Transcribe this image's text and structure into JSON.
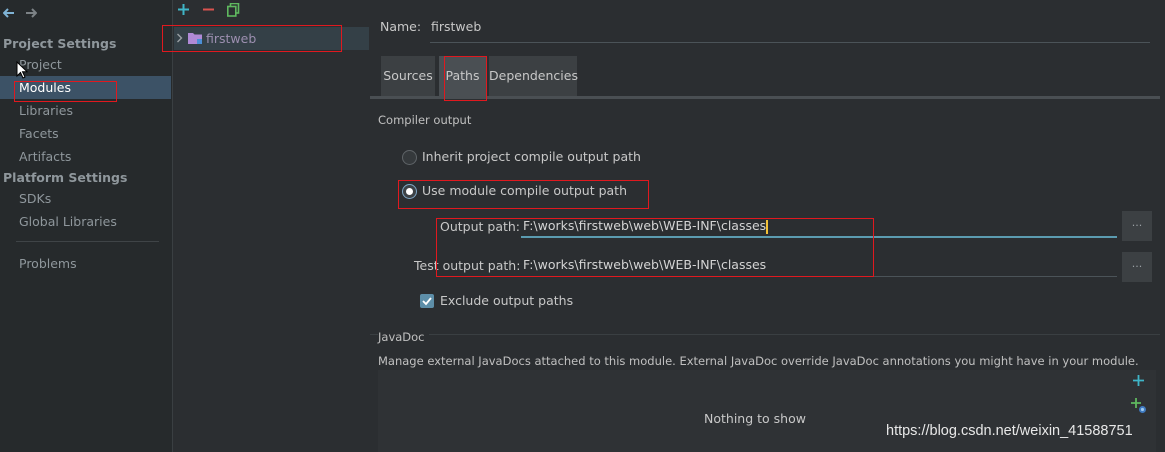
{
  "sidebar": {
    "back_icon": "arrow-left-icon",
    "forward_icon": "arrow-right-icon",
    "project_settings_header": "Project Settings",
    "project_settings_items": [
      "Project",
      "Modules",
      "Libraries",
      "Facets",
      "Artifacts"
    ],
    "platform_settings_header": "Platform Settings",
    "platform_settings_items": [
      "SDKs",
      "Global Libraries"
    ],
    "problems_label": "Problems",
    "selected": "Modules"
  },
  "tree": {
    "toolbar": [
      "add-icon",
      "remove-icon",
      "copy-icon"
    ],
    "module_name": "firstweb"
  },
  "module": {
    "name_label": "Name:",
    "name_value": "firstweb",
    "tabs": [
      "Sources",
      "Paths",
      "Dependencies"
    ],
    "active_tab": "Paths"
  },
  "compiler_output": {
    "title": "Compiler output",
    "inherit_label": "Inherit project compile output path",
    "use_module_label": "Use module compile output path",
    "selected_option": "use_module",
    "output_path_label": "Output path:",
    "output_path_value": "F:\\works\\firstweb\\web\\WEB-INF\\classes",
    "test_output_path_label": "Test output path:",
    "test_output_path_value": "F:\\works\\firstweb\\web\\WEB-INF\\classes",
    "browse_label": "...",
    "exclude_label": "Exclude output paths",
    "exclude_checked": true
  },
  "javadoc": {
    "title": "JavaDoc",
    "description": "Manage external JavaDocs attached to this module. External JavaDoc override JavaDoc annotations you might have in your module.",
    "empty_text": "Nothing to show",
    "add_icon": "add-icon",
    "add_url_icon": "add-url-icon"
  },
  "watermark": "https://blog.csdn.net/weixin_41588751",
  "colors": {
    "background": "#2b2e31",
    "sidebar_background": "#262a2c",
    "selection": "#3c5266",
    "highlight_box": "#e0191f",
    "focus_underline": "#5b9bb0",
    "add_icon": "#3fb5c7",
    "remove_icon": "#d9534f"
  }
}
